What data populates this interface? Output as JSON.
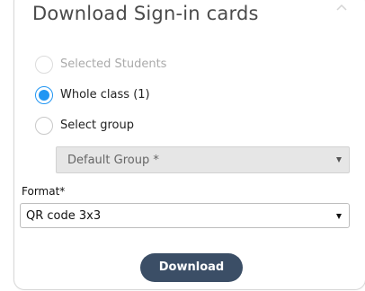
{
  "panel": {
    "title": "Download Sign-in cards"
  },
  "recipients": {
    "options": [
      {
        "label": "Selected Students",
        "state": "disabled"
      },
      {
        "label": "Whole class (1)",
        "state": "checked"
      },
      {
        "label": "Select group",
        "state": "unchecked"
      }
    ],
    "group_select": {
      "value": "Default Group *",
      "enabled": false
    }
  },
  "format": {
    "label": "Format*",
    "value": "QR code 3x3"
  },
  "actions": {
    "download_label": "Download"
  },
  "colors": {
    "accent": "#2196f3",
    "button": "#3b4e66"
  }
}
